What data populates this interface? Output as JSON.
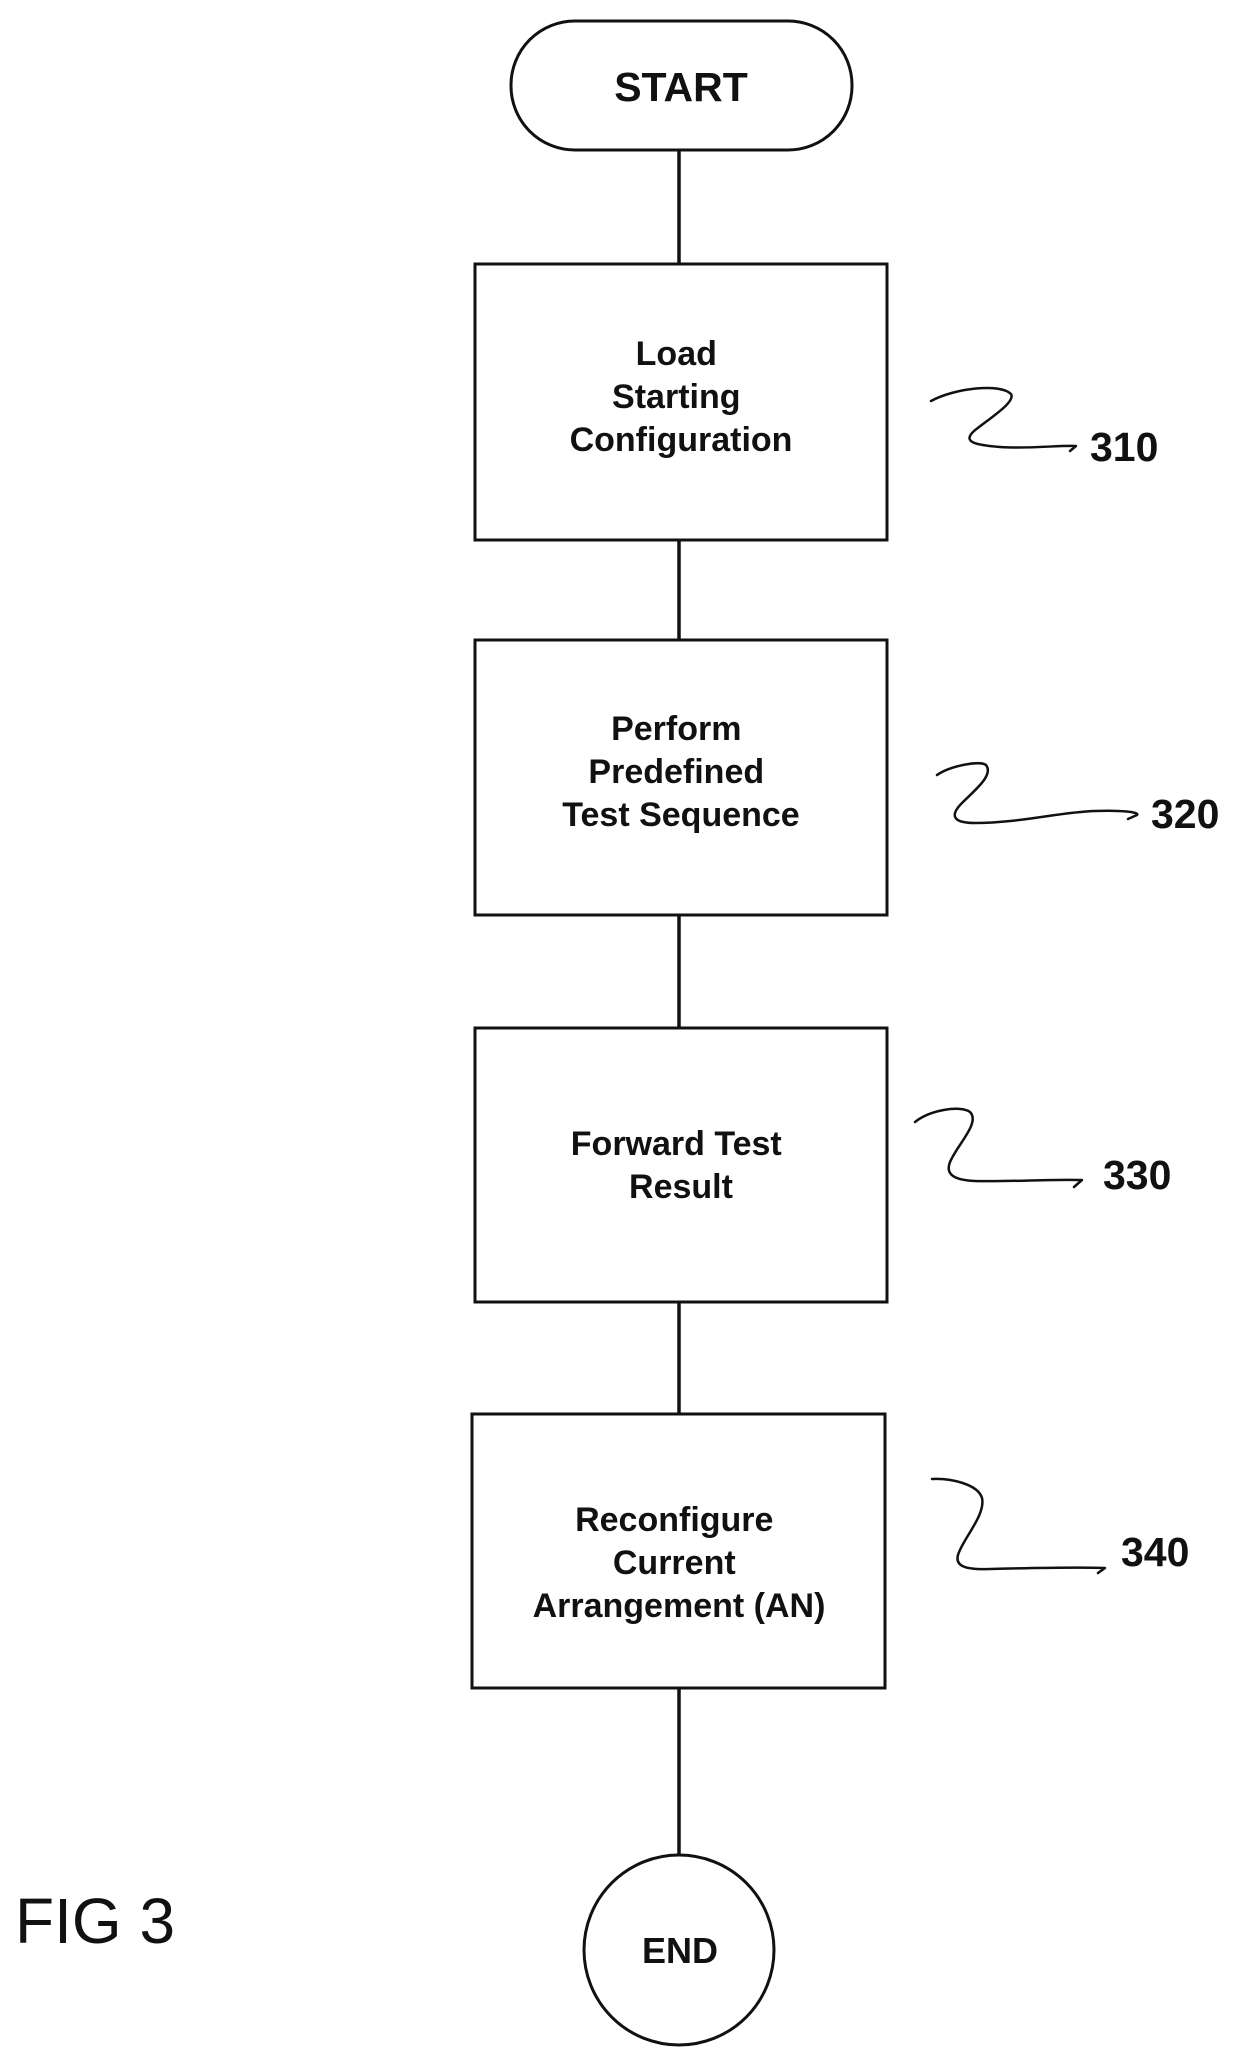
{
  "figure": {
    "label": "FIG 3"
  },
  "flowchart": {
    "start": {
      "label": "START",
      "shape": "terminator"
    },
    "steps": [
      {
        "ref": "310",
        "lines": [
          "Load",
          "Starting",
          "Configuration"
        ]
      },
      {
        "ref": "320",
        "lines": [
          "Perform",
          "Predefined",
          "Test Sequence"
        ]
      },
      {
        "ref": "330",
        "lines": [
          "Forward Test",
          "Result"
        ]
      },
      {
        "ref": "340",
        "lines": [
          "Reconfigure",
          "Current",
          "Arrangement (AN)"
        ]
      }
    ],
    "end": {
      "label": "END",
      "shape": "circle"
    },
    "colors": {
      "ink": "#111111",
      "background": "#ffffff"
    }
  }
}
